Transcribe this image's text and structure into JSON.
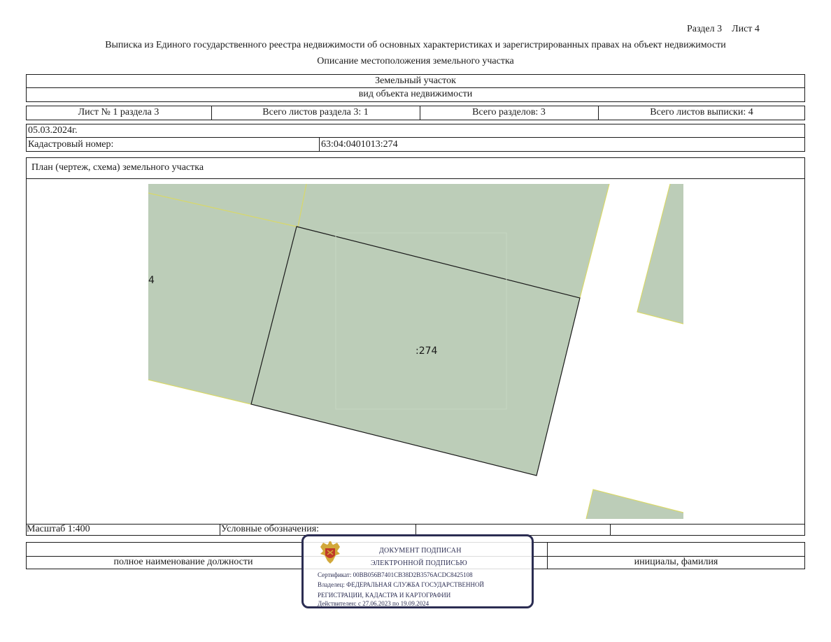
{
  "header": {
    "section_sheet": "Раздел 3    Лист 4",
    "extract_title": "Выписка из Единого государственного реестра недвижимости об основных характеристиках и зарегистрированных правах на объект недвижимости",
    "subtitle": "Описание местоположения земельного участка"
  },
  "object": {
    "type": "Земельный участок",
    "type_caption": "вид объекта недвижимости"
  },
  "sheets": {
    "sheet_no": "Лист № 1 раздела 3",
    "total_sheets_section": "Всего листов раздела 3: 1",
    "total_sections": "Всего разделов: 3",
    "total_sheets_extract": "Всего листов выписки: 4"
  },
  "info": {
    "date": "05.03.2024г.",
    "cadastral_label": "Кадастровый номер:",
    "cadastral_number": "63:04:0401013:274"
  },
  "plan": {
    "title": "План (чертеж, схема) земельного участка",
    "parcel_label": ":274",
    "neighbor_label": "4",
    "scale": "Масштаб 1:400",
    "legend_label": "Условные обозначения:",
    "colors": {
      "parcel_fill": "#bccdb8",
      "boundary_neighbor": "#d8d86a",
      "boundary_main": "#1a1a1a"
    }
  },
  "signature": {
    "position_caption": "полное наименование должности",
    "initials_caption": "инициалы, фамилия"
  },
  "stamp": {
    "line1": "ДОКУМЕНТ ПОДПИСАН",
    "line2": "ЭЛЕКТРОННОЙ ПОДПИСЬЮ",
    "certificate": "Сертификат: 00BB056B7401CB38D2B3576ACDC8425108",
    "owner1": "Владелец: ФЕДЕРАЛЬНАЯ СЛУЖБА ГОСУДАРСТВЕННОЙ",
    "owner2": "РЕГИСТРАЦИИ, КАДАСТРА И КАРТОГРАФИИ",
    "valid": "Действителен: с 27.06.2023 по 19.09.2024",
    "emblem_icon": "eagle-emblem-icon",
    "color": "#2b2d52"
  }
}
